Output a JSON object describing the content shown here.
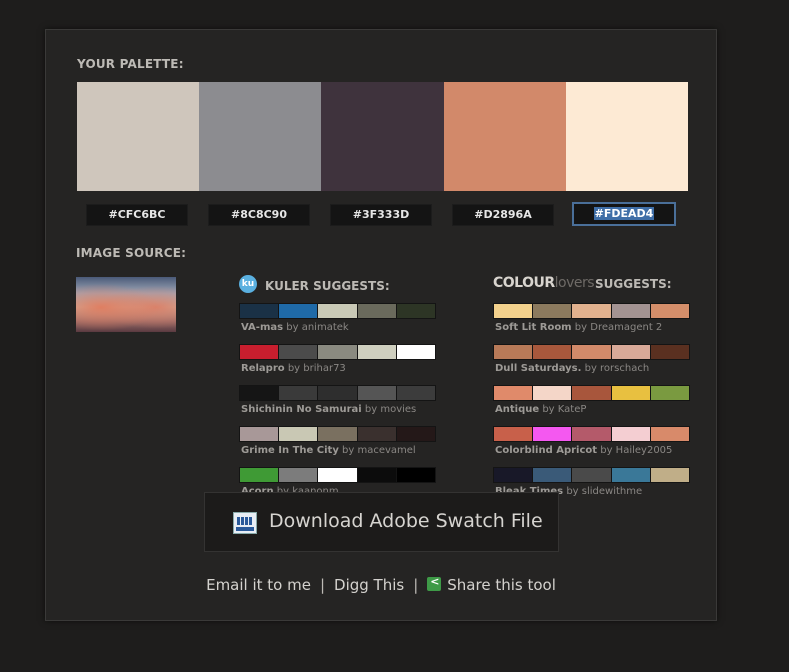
{
  "palette": {
    "label": "YOUR PALETTE:",
    "colors": [
      {
        "hex": "#CFC6BC",
        "fill": "#CFC6BC"
      },
      {
        "hex": "#8C8C90",
        "fill": "#8C8C90"
      },
      {
        "hex": "#3F333D",
        "fill": "#3F333D"
      },
      {
        "hex": "#D2896A",
        "fill": "#D2896A"
      },
      {
        "hex": "#FDEAD4",
        "fill": "#FDEAD4"
      }
    ],
    "selected_index": 4
  },
  "image_source": {
    "label": "IMAGE SOURCE:"
  },
  "kuler": {
    "icon": "kuler-icon",
    "icon_text": "ku",
    "label": "KULER SUGGESTS:",
    "themes": [
      {
        "name": "VA-mas",
        "by": "by animatek",
        "colors": [
          "#1a3146",
          "#1f6aa8",
          "#c9c9b6",
          "#6a6a5c",
          "#2d3525"
        ]
      },
      {
        "name": "Relapro",
        "by": "by brihar73",
        "colors": [
          "#c81e2e",
          "#4b4b4b",
          "#8a8a80",
          "#cfcfbf",
          "#ffffff"
        ]
      },
      {
        "name": "Shichinin No Samurai",
        "by": "by movies",
        "colors": [
          "#151515",
          "#3a3a3a",
          "#2e2e2e",
          "#555555",
          "#3c3c3c"
        ]
      },
      {
        "name": "Grime In The City",
        "by": "by macevamel",
        "colors": [
          "#a89898",
          "#c9c8b4",
          "#7a7060",
          "#3a302e",
          "#241818"
        ]
      },
      {
        "name": "Acorn",
        "by": "by kaanonm",
        "colors": [
          "#3f9a35",
          "#7c7c7c",
          "#ffffff",
          "#0c0c0c",
          "#000000"
        ]
      }
    ]
  },
  "colourlovers": {
    "logo_bold": "COLOUR",
    "logo_light": "lovers",
    "label": "SUGGESTS:",
    "themes": [
      {
        "name": "Soft Lit Room",
        "by": "by Dreamagent 2",
        "colors": [
          "#f3d18c",
          "#8c7a5e",
          "#e1b18e",
          "#a39392",
          "#d48e6a"
        ]
      },
      {
        "name": "Dull Saturdays.",
        "by": "by rorschach",
        "colors": [
          "#b87a58",
          "#a8583c",
          "#d28a6a",
          "#d8a998",
          "#5a3020"
        ]
      },
      {
        "name": "Antique",
        "by": "by KateP",
        "colors": [
          "#e08a6a",
          "#f4d6c8",
          "#a8563c",
          "#e8c040",
          "#7a9a40"
        ]
      },
      {
        "name": "Colorblind Apricot",
        "by": "by Hailey2005",
        "colors": [
          "#c8604a",
          "#f458f0",
          "#b45a6a",
          "#f4ced2",
          "#d88a6a"
        ]
      },
      {
        "name": "Bleak Times",
        "by": "by slidewithme",
        "colors": [
          "#181828",
          "#3a5a78",
          "#4a4a4a",
          "#3a7898",
          "#c0ae88"
        ]
      }
    ]
  },
  "download": {
    "label": "Download Adobe Swatch File",
    "icon": "swatch-file-icon"
  },
  "footer": {
    "email": "Email it to me",
    "sep1": "|",
    "digg": "Digg This",
    "sep2": "|",
    "share": "Share this tool",
    "share_icon": "share-icon"
  }
}
